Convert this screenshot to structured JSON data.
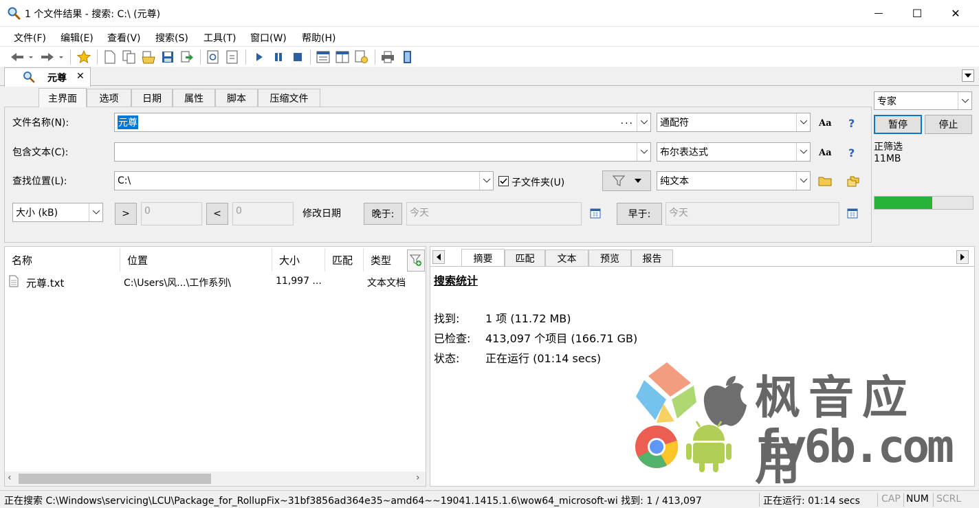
{
  "window": {
    "title": "1 个文件结果 - 搜索: C:\\ (元尊)",
    "minimize_glyph": "—",
    "maximize_glyph": "☐",
    "close_glyph": "✕"
  },
  "menu": [
    "文件(F)",
    "编辑(E)",
    "查看(V)",
    "搜索(S)",
    "工具(T)",
    "窗口(W)",
    "帮助(H)"
  ],
  "doc_tab": {
    "label": "元尊",
    "close": "✕"
  },
  "mode_select": {
    "value": "专家"
  },
  "subtabs": [
    "主界面",
    "选项",
    "日期",
    "属性",
    "脚本",
    "压缩文件"
  ],
  "form": {
    "filename_label": "文件名称(N):",
    "filename_value": "元尊",
    "filename_ellipsis": "...",
    "filename_mode": "通配符",
    "contains_label": "包含文本(C):",
    "contains_value": "",
    "contains_mode": "布尔表达式",
    "location_label": "查找位置(L):",
    "location_value": "C:\\",
    "subfolder_label": "子文件夹(U)",
    "subfolder_checked": true,
    "location_mode": "纯文本",
    "size_select": "大小 (kB)",
    "gt": ">",
    "lt": "<",
    "size_min": "0",
    "size_max": "0",
    "modified_label": "修改日期",
    "later_btn": "晚于:",
    "later_value": "今天",
    "earlier_btn": "早于:",
    "earlier_value": "今天",
    "case_label": "Aa",
    "help_label": "?"
  },
  "side": {
    "pause": "暂停",
    "stop": "停止",
    "status_line1": "正筛选",
    "status_line2": "11MB",
    "progress": 0.59,
    "progress_color": "#26b33a"
  },
  "list": {
    "columns": [
      "名称",
      "位置",
      "大小",
      "匹配",
      "类型"
    ],
    "rows": [
      {
        "name": "元尊.txt",
        "location": "C:\\Users\\风...\\工作系列\\",
        "size": "11,997 ...",
        "match": "",
        "type": "文本文档"
      }
    ]
  },
  "right_tabs": [
    "摘要",
    "匹配",
    "文本",
    "预览",
    "报告"
  ],
  "summary": {
    "heading": "搜索统计",
    "found_label": "找到:",
    "found_value": "1 项 (11.72 MB)",
    "checked_label": "已检查:",
    "checked_value": "413,097 个项目 (166.71 GB)",
    "status_label": "状态:",
    "status_value": "正在运行 (01:14 secs)"
  },
  "watermark": {
    "text1": "枫音应用",
    "text2": "fy6b.com"
  },
  "statusbar": {
    "path": "正在搜索 C:\\Windows\\servicing\\LCU\\Package_for_RollupFix~31bf3856ad364e35~amd64~~19041.1415.1.6\\wow64_microsoft-wi 找到: 1 / 413,097",
    "running": "正在运行: 01:14 secs",
    "cap": "CAP",
    "num": "NUM",
    "scrl": "SCRL"
  }
}
